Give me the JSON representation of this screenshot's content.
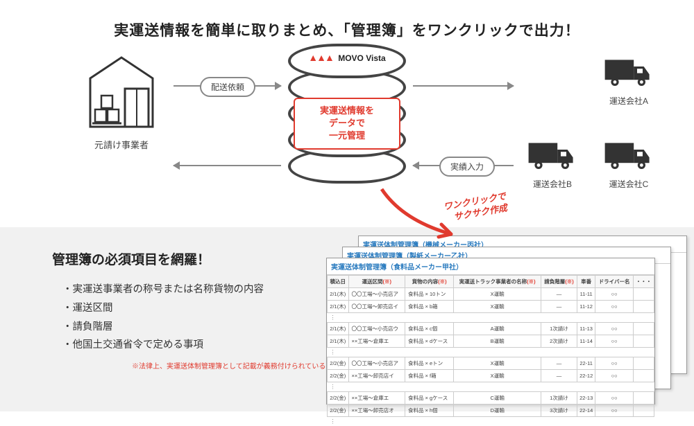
{
  "headline": "実運送情報を簡単に取りまとめ、「管理簿」をワンクリックで出力！",
  "contractor_label": "元請け事業者",
  "brand": {
    "logo_text": "MOVO",
    "name": "Vista"
  },
  "db_label": {
    "l1": "実運送情報を",
    "l2": "データで",
    "l3": "一元管理"
  },
  "arrows": {
    "request": "配送依頼",
    "result": "実績入力"
  },
  "trucks": {
    "a": "運送会社A",
    "b": "運送会社B",
    "c": "運送会社C"
  },
  "red_anno": {
    "l1": "ワンクリックで",
    "l2": "サクサク作成"
  },
  "requirements": {
    "title": "管理簿の必須項目を網羅！",
    "items": [
      "実運送事業者の称号または名称貨物の内容",
      "運送区間",
      "請負階層",
      "他国土交通省令で定める事項"
    ],
    "footnote": "※法律上、実運送体制管理簿として記載が義務付けられている事項"
  },
  "tables": {
    "t3_title": "実運送体制管理簿（機械メーカー丙社）",
    "t2_title": "実運送体制管理簿（製紙メーカー乙社）",
    "t1_title": "実運送体制管理簿（食料品メーカー甲社）",
    "headers": [
      "積込日",
      "運送区間",
      "",
      "貨物の内容",
      "",
      "実運送トラック事業者の名称",
      "",
      " 請負階層",
      "",
      "車番",
      "ドライバー名",
      "・・・"
    ],
    "header_marks": [
      "",
      "",
      "(※)",
      "",
      "(※)",
      "",
      "(※)",
      "",
      "(※)",
      "",
      "",
      ""
    ],
    "rows": [
      {
        "date": "2/1(木)",
        "zone": "〇〇工場～小売店ア",
        "cargo": "食料品 × 10トン",
        "carrier": "X運輸",
        "tier": "—",
        "car": "11-11",
        "drv": "○○"
      },
      {
        "date": "2/1(木)",
        "zone": "〇〇工場～卸売店イ",
        "cargo": "食料品 × b箱",
        "carrier": "X運輸",
        "tier": "—",
        "car": "11-12",
        "drv": "○○"
      }
    ],
    "rows2": [
      {
        "date": "2/1(木)",
        "zone": "〇〇工場～小売店ウ",
        "cargo": "食料品 × c個",
        "carrier": "A運輸",
        "tier": "1次請け",
        "car": "11-13",
        "drv": "○○"
      },
      {
        "date": "2/1(木)",
        "zone": "××工場～倉庫エ",
        "cargo": "食料品 × dケース",
        "carrier": "B運輸",
        "tier": "2次請け",
        "car": "11-14",
        "drv": "○○"
      }
    ],
    "rows3": [
      {
        "date": "2/2(金)",
        "zone": "〇〇工場～小売店ア",
        "cargo": "食料品 × eトン",
        "carrier": "X運輸",
        "tier": "—",
        "car": "22-11",
        "drv": "○○"
      },
      {
        "date": "2/2(金)",
        "zone": "××工場～卸売店イ",
        "cargo": "食料品 × f箱",
        "carrier": "X運輸",
        "tier": "—",
        "car": "22-12",
        "drv": "○○"
      }
    ],
    "rows4": [
      {
        "date": "2/2(金)",
        "zone": "××工場～倉庫エ",
        "cargo": "食料品 × gケース",
        "carrier": "C運輸",
        "tier": "1次請け",
        "car": "22-13",
        "drv": "○○"
      },
      {
        "date": "2/2(金)",
        "zone": "××工場～卸売店オ",
        "cargo": "食料品 × h個",
        "carrier": "D運輸",
        "tier": "3次請け",
        "car": "22-14",
        "drv": "○○"
      }
    ],
    "dots": "⋮"
  }
}
